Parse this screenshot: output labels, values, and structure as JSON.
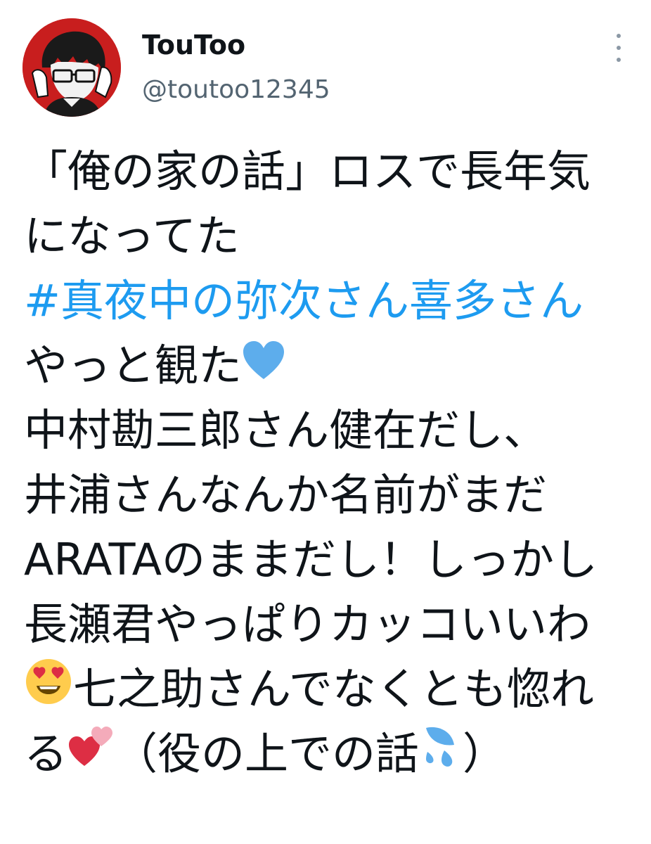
{
  "user": {
    "display_name": "TouToo",
    "handle": "@toutoo12345",
    "avatar_bg": "#c81e1e"
  },
  "menu": {
    "icon": "more-vertical-icon"
  },
  "tweet": {
    "line1": "「俺の家の話」ロスで長年気",
    "line2": "になってた",
    "hashtag": "#真夜中の弥次さん喜多さん",
    "line4": "やっと観た",
    "line5": "中村勘三郎さん健在だし、",
    "line6": "井浦さんなんか名前がまだ",
    "line7": "ARATAのままだし！しっかし",
    "line8": "長瀬君やっぱりカッコいいわ",
    "line9": "七之助さんでなくとも惚れ",
    "line10a": "る",
    "line10b": "（役の上での話",
    "line10c": "）"
  },
  "emojis": {
    "blue_heart": "blue-heart-icon",
    "heart_eyes": "heart-eyes-icon",
    "two_hearts": "two-hearts-icon",
    "sweat_drops": "sweat-drops-icon"
  },
  "colors": {
    "text": "#0f1419",
    "handle": "#536471",
    "hashtag": "#1d9bf0",
    "blue_heart": "#5dadec",
    "pink_heart": "#dd2e44"
  }
}
